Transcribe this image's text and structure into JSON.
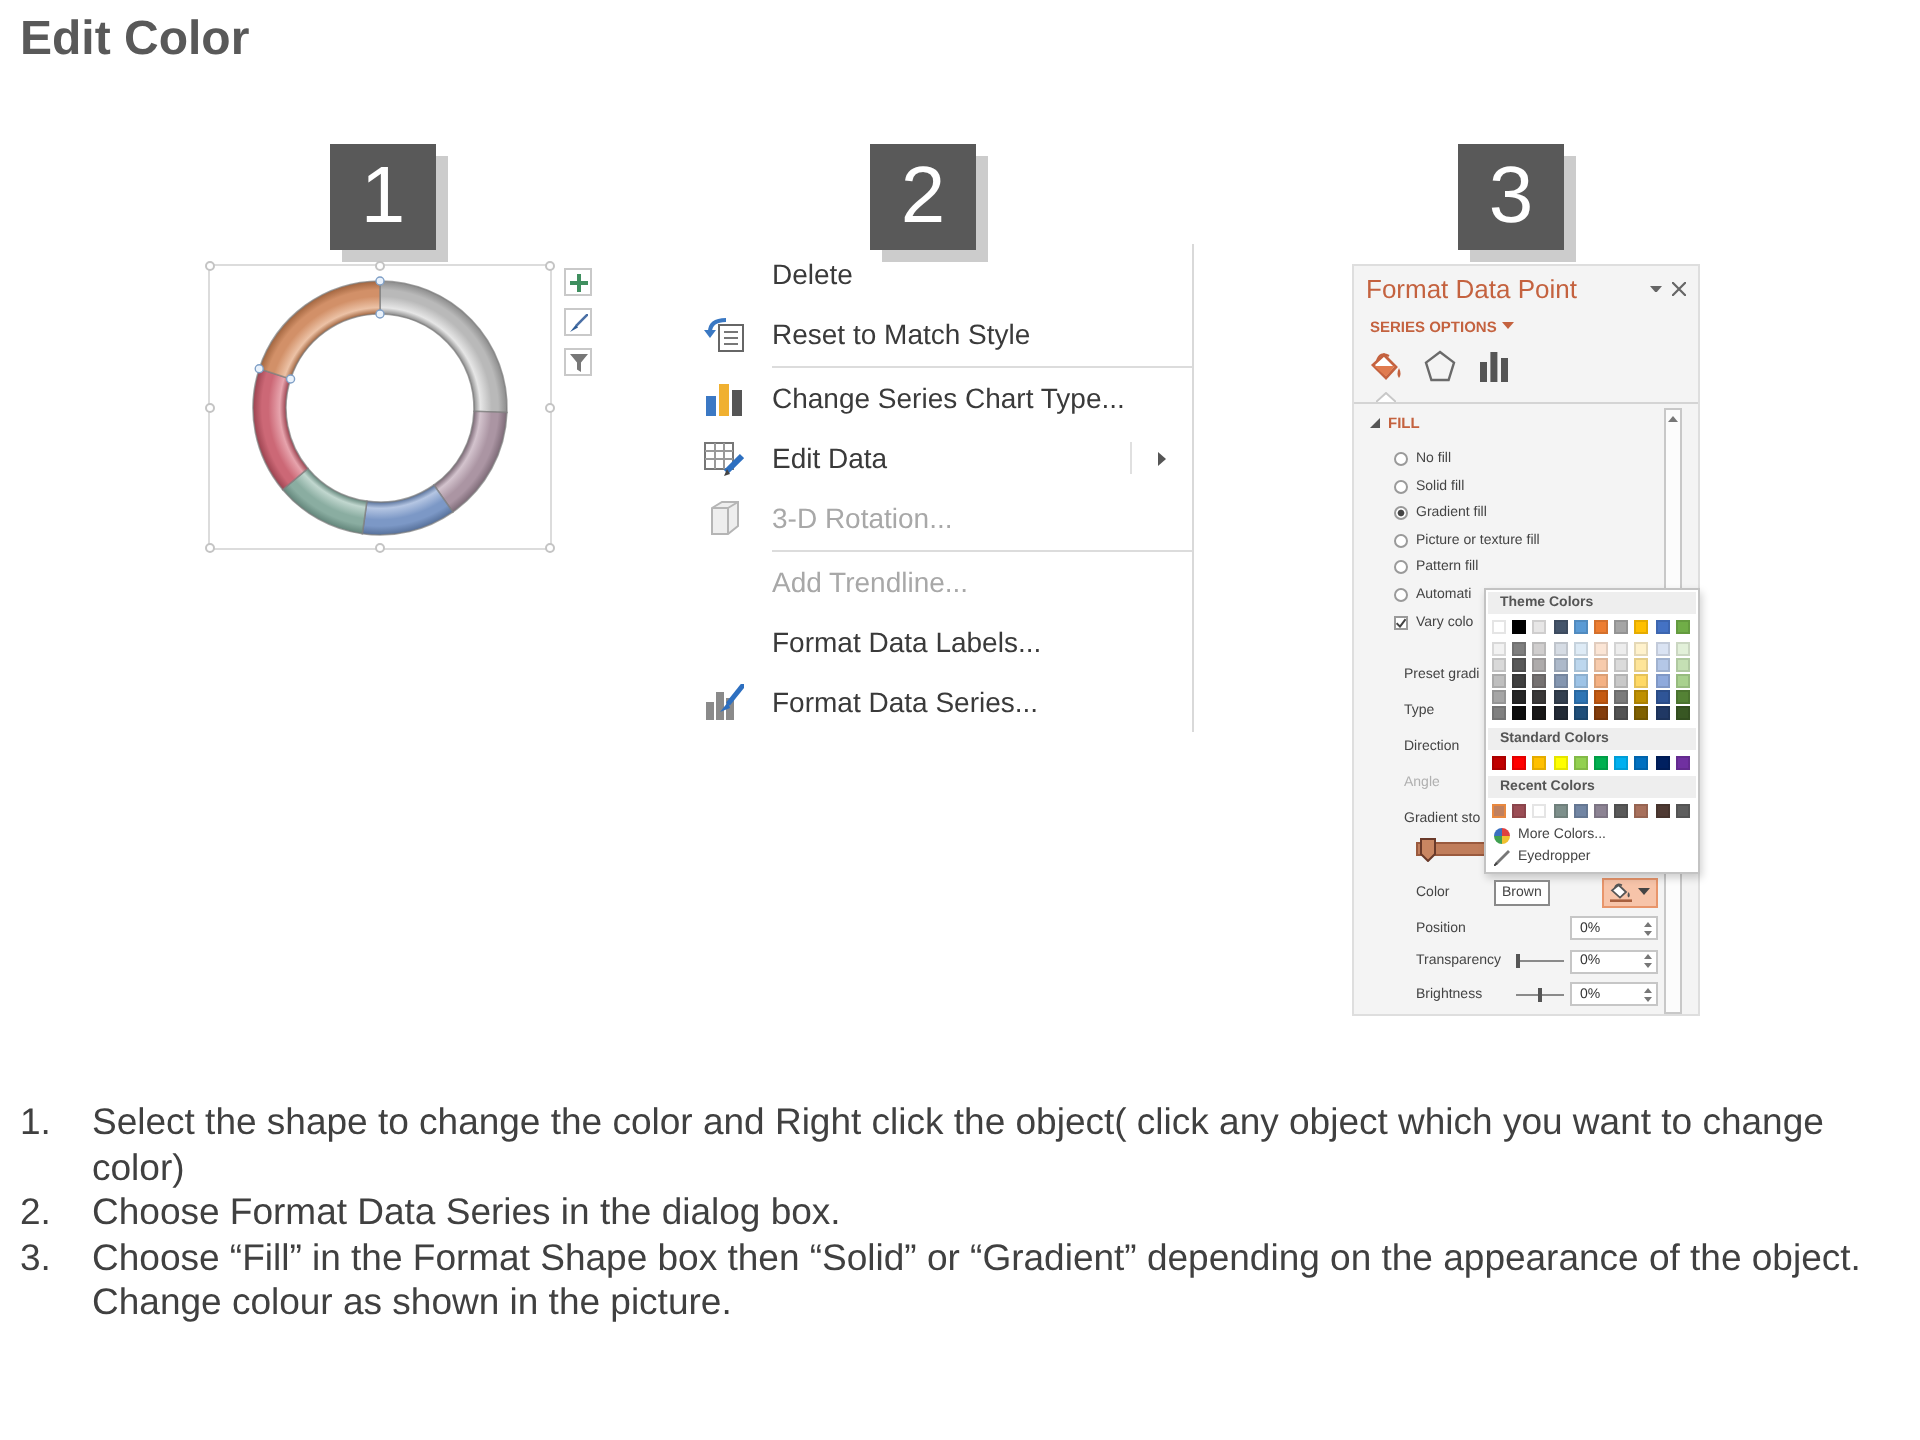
{
  "title": "Edit Color",
  "steps": [
    {
      "number": "1"
    },
    {
      "number": "2"
    },
    {
      "number": "3"
    }
  ],
  "context_menu": {
    "groups": [
      {
        "items": [
          {
            "label": "Delete",
            "disabled": false,
            "submenu": false
          },
          {
            "label": "Reset to Match Style",
            "disabled": false,
            "submenu": false
          }
        ]
      },
      {
        "items": [
          {
            "label": "Change Series Chart Type...",
            "disabled": false,
            "submenu": false
          },
          {
            "label": "Edit Data",
            "disabled": false,
            "submenu": true
          },
          {
            "label": "3-D Rotation...",
            "disabled": true,
            "submenu": false
          }
        ]
      },
      {
        "items": [
          {
            "label": "Add Trendline...",
            "disabled": true,
            "submenu": false
          },
          {
            "label": "Format Data Labels...",
            "disabled": false,
            "submenu": false
          },
          {
            "label": "Format Data Series...",
            "disabled": false,
            "submenu": false
          }
        ]
      }
    ]
  },
  "format_pane": {
    "title": "Format Data Point",
    "section_menu": "SERIES OPTIONS",
    "tabs": [
      {
        "selected": true
      },
      {
        "selected": false
      },
      {
        "selected": false
      }
    ],
    "fill": {
      "label": "FILL",
      "expanded": true,
      "options": [
        {
          "label": "No fill",
          "selected": false
        },
        {
          "label": "Solid fill",
          "selected": false
        },
        {
          "label": "Gradient fill",
          "selected": true
        },
        {
          "label": "Picture or texture fill",
          "selected": false
        },
        {
          "label": "Pattern fill",
          "selected": false
        },
        {
          "label": "Automati",
          "selected": false
        }
      ],
      "vary_colors": {
        "label": "Vary colo",
        "checked": true
      }
    },
    "gradient_rows": [
      {
        "label": "Preset gradi",
        "disabled": false
      },
      {
        "label": "Type",
        "disabled": false
      },
      {
        "label": "Direction",
        "disabled": false
      },
      {
        "label": "Angle",
        "disabled": true
      },
      {
        "label": "Gradient sto",
        "disabled": false
      }
    ],
    "color_control": {
      "label": "Color",
      "open": true
    },
    "properties": [
      {
        "kind": "field",
        "label": "Position",
        "value": "0%"
      },
      {
        "kind": "slider",
        "label": "Transparency",
        "value": "0%",
        "level": 0
      },
      {
        "kind": "slider",
        "label": "Brightness",
        "value": "0%",
        "level": 0.5
      }
    ]
  },
  "color_picker": {
    "sections": [
      {
        "kind": "theme",
        "heading": "Theme Colors",
        "colors": [
          {
            "color": "#ffffff",
            "shades": [
              {
                "color": "#f2f2f2"
              },
              {
                "color": "#d9d9d9"
              },
              {
                "color": "#bfbfbf"
              },
              {
                "color": "#a6a6a6"
              },
              {
                "color": "#808080"
              }
            ]
          },
          {
            "color": "#000000",
            "shades": [
              {
                "color": "#7f7f7f"
              },
              {
                "color": "#595959"
              },
              {
                "color": "#404040"
              },
              {
                "color": "#262626"
              },
              {
                "color": "#0d0d0d"
              }
            ]
          },
          {
            "color": "#e7e6e6",
            "shades": [
              {
                "color": "#d0cece"
              },
              {
                "color": "#aeabab"
              },
              {
                "color": "#757171"
              },
              {
                "color": "#3a3838"
              },
              {
                "color": "#171616"
              }
            ]
          },
          {
            "color": "#44546a",
            "shades": [
              {
                "color": "#d6dce4"
              },
              {
                "color": "#adb9ca"
              },
              {
                "color": "#8496b0"
              },
              {
                "color": "#333f4f"
              },
              {
                "color": "#222a35"
              }
            ]
          },
          {
            "color": "#5b9bd5",
            "shades": [
              {
                "color": "#deebf6"
              },
              {
                "color": "#bdd7ee"
              },
              {
                "color": "#9dc3e6"
              },
              {
                "color": "#2e75b5"
              },
              {
                "color": "#1f4e79"
              }
            ]
          },
          {
            "color": "#ed7d31",
            "shades": [
              {
                "color": "#fbe5d5"
              },
              {
                "color": "#f7cbac"
              },
              {
                "color": "#f4b183"
              },
              {
                "color": "#c55a11"
              },
              {
                "color": "#833c0b"
              }
            ]
          },
          {
            "color": "#a5a5a5",
            "shades": [
              {
                "color": "#ededed"
              },
              {
                "color": "#dbdbdb"
              },
              {
                "color": "#c9c9c9"
              },
              {
                "color": "#7b7b7b"
              },
              {
                "color": "#525252"
              }
            ]
          },
          {
            "color": "#ffc000",
            "shades": [
              {
                "color": "#fff2cc"
              },
              {
                "color": "#fee599"
              },
              {
                "color": "#ffd965"
              },
              {
                "color": "#bf9000"
              },
              {
                "color": "#7f6000"
              }
            ]
          },
          {
            "color": "#4472c4",
            "shades": [
              {
                "color": "#dae3f3"
              },
              {
                "color": "#b4c7e7"
              },
              {
                "color": "#8faadc"
              },
              {
                "color": "#2f5597"
              },
              {
                "color": "#203864"
              }
            ]
          },
          {
            "color": "#70ad47",
            "shades": [
              {
                "color": "#e2f0d9"
              },
              {
                "color": "#c5e0b4"
              },
              {
                "color": "#a9d18e"
              },
              {
                "color": "#548235"
              },
              {
                "color": "#385723"
              }
            ]
          }
        ]
      },
      {
        "kind": "standard",
        "heading": "Standard Colors",
        "colors": [
          {
            "color": "#c00000"
          },
          {
            "color": "#ff0000"
          },
          {
            "color": "#ffc000"
          },
          {
            "color": "#ffff00"
          },
          {
            "color": "#92d050"
          },
          {
            "color": "#00b050"
          },
          {
            "color": "#00b0f0"
          },
          {
            "color": "#0070c0"
          },
          {
            "color": "#002060"
          },
          {
            "color": "#7030a0"
          }
        ]
      },
      {
        "kind": "recent",
        "heading": "Recent Colors",
        "colors": [
          {
            "color": "#c0805e",
            "hovered": true
          },
          {
            "color": "#9b4d55",
            "hovered": false
          },
          {
            "color": "#ffffff",
            "hovered": false
          },
          {
            "color": "#7d8f8b",
            "hovered": false
          },
          {
            "color": "#7185a3",
            "hovered": false
          },
          {
            "color": "#8c8393",
            "hovered": false
          },
          {
            "color": "#595959",
            "hovered": false
          },
          {
            "color": "#a8705c",
            "hovered": false
          },
          {
            "color": "#4f3a33",
            "hovered": false
          },
          {
            "color": "#5e5e5e",
            "hovered": false
          }
        ]
      }
    ],
    "more_colors": "More Colors...",
    "eyedropper": "Eyedropper",
    "tooltip": "Brown"
  },
  "instructions": [
    {
      "number": "1.",
      "text": "Select the shape to change the color and Right click the object( click any object which you want to change color)"
    },
    {
      "number": "2.",
      "text": "Choose Format Data Series in the dialog box."
    },
    {
      "number": "3.",
      "text": "Choose “Fill” in the Format Shape box then “Solid” or “Gradient” depending on the appearance of the object. Change colour as shown in the picture."
    }
  ]
}
